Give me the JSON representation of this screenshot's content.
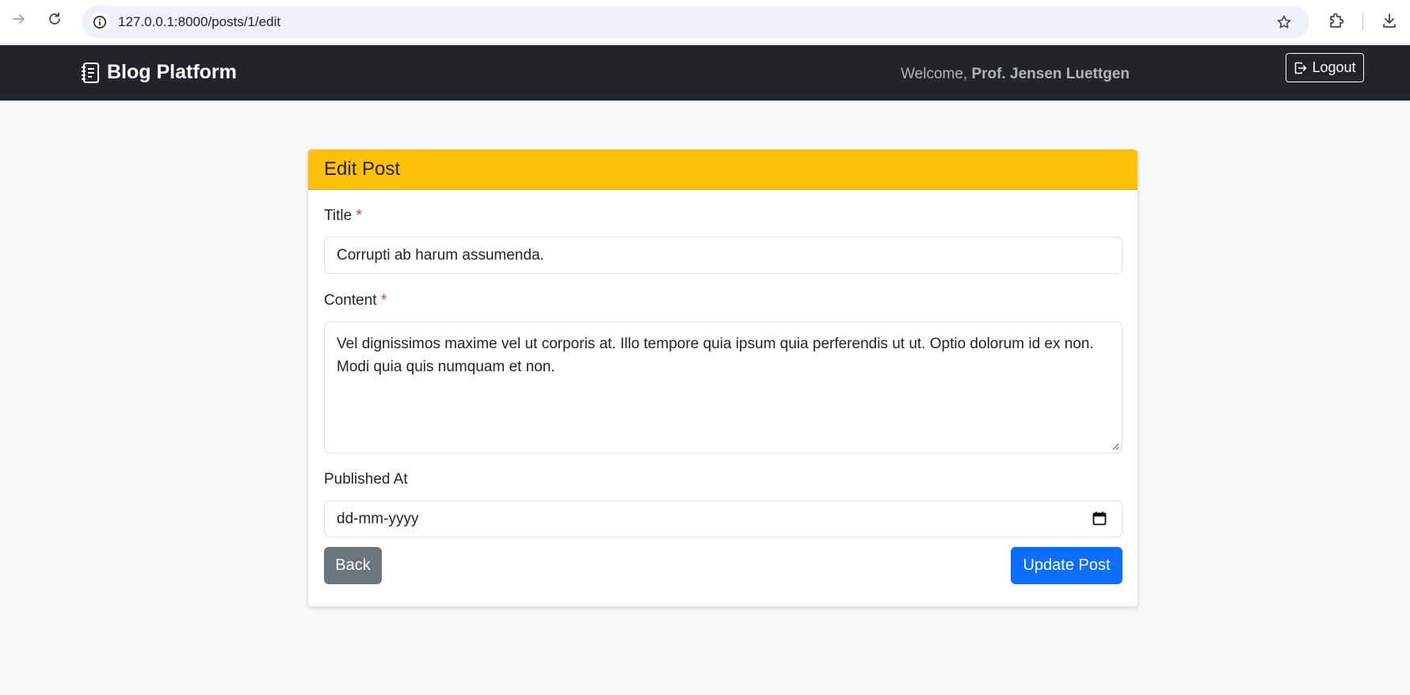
{
  "browser": {
    "url": "127.0.0.1:8000/posts/1/edit"
  },
  "navbar": {
    "brand": "Blog Platform",
    "welcome_prefix": "Welcome, ",
    "user_name": "Prof. Jensen Luettgen",
    "logout_label": "Logout"
  },
  "form": {
    "heading": "Edit Post",
    "title_label": "Title",
    "title_value": "Corrupti ab harum assumenda.",
    "content_label": "Content",
    "content_value": "Vel dignissimos maxime vel ut corporis at. Illo tempore quia ipsum quia perferendis ut ut. Optio dolorum id ex non. Modi quia quis numquam et non.",
    "published_label": "Published At",
    "published_placeholder": "dd-mm-yyyy",
    "required_marker": "*",
    "back_label": "Back",
    "update_label": "Update Post"
  },
  "colors": {
    "navbar_bg": "#212529",
    "card_header_bg": "#ffc107",
    "primary": "#0d6efd",
    "secondary": "#6c757d",
    "required": "#dc3545"
  },
  "icons": {
    "forward": "arrow-right-icon",
    "reload": "reload-icon",
    "site_info": "info-icon",
    "bookmark": "star-icon",
    "extensions": "puzzle-icon",
    "downloads": "download-icon",
    "brand": "journal-text-icon",
    "logout": "box-arrow-right-icon",
    "date_picker": "calendar-icon"
  }
}
